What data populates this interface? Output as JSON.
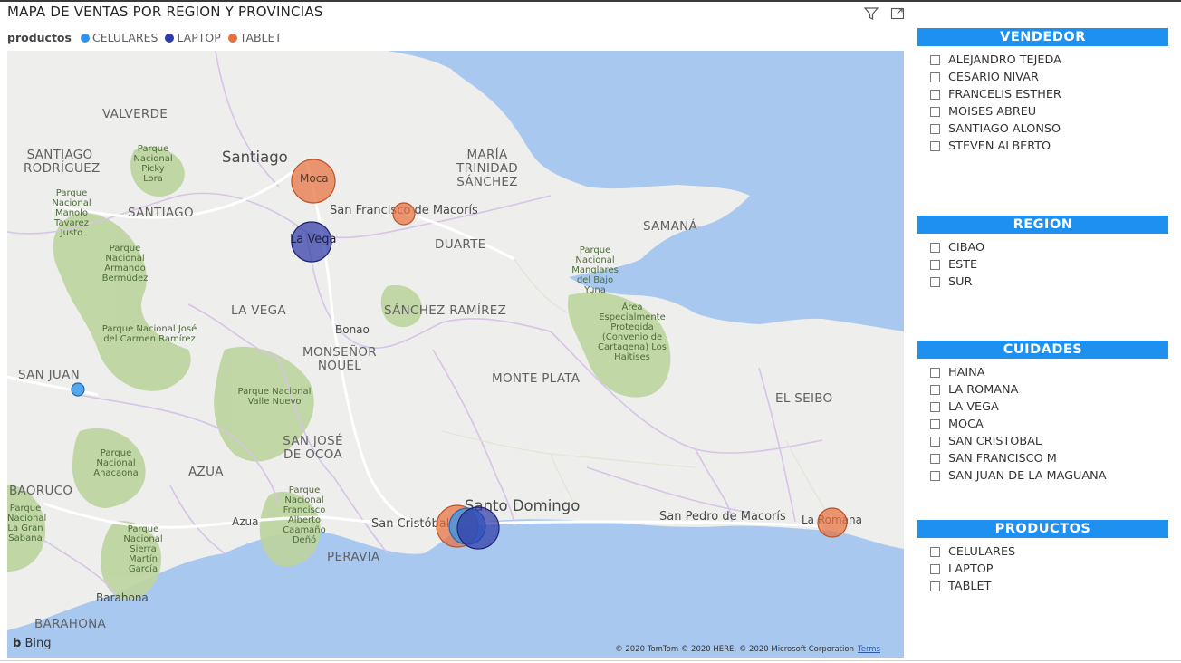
{
  "visual": {
    "title": "MAPA DE VENTAS POR REGION Y PROVINCIAS",
    "filter_icon": "filter-icon",
    "focus_icon": "focus-mode-icon"
  },
  "legend": {
    "title": "productos",
    "items": [
      {
        "label": "CELULARES",
        "color": "#2e93f0"
      },
      {
        "label": "LAPTOP",
        "color": "#2f3aa8"
      },
      {
        "label": "TABLET",
        "color": "#e8703f"
      }
    ]
  },
  "map": {
    "water_color": "#a8c8f0",
    "land_color": "#eeeeec",
    "park_color": "#bcd49e",
    "labels": {
      "valverde": "VALVERDE",
      "santiago_rodriguez": "SANTIAGO RODRÍGUEZ",
      "santiago_city": "Santiago",
      "santiago_prov": "SANTIAGO",
      "maria_trinidad": "MARÍA TRINIDAD SÁNCHEZ",
      "sf_macoris": "San Francisco de Macorís",
      "duarte": "DUARTE",
      "samana": "SAMANÁ",
      "la_vega_city": "La Vega",
      "la_vega_prov": "LA VEGA",
      "moca": "Moca",
      "sanchez_ramirez": "SÁNCHEZ RAMÍREZ",
      "bonao": "Bonao",
      "monsenor_nouel": "MONSEÑOR NOUEL",
      "monte_plata": "MONTE PLATA",
      "san_juan": "SAN JUAN",
      "el_seibo": "EL SEIBO",
      "san_jose_ocoa": "SAN JOSÉ DE OCOA",
      "azua_prov": "AZUA",
      "azua_city": "Azua",
      "baoruco": "BAORUCO",
      "santo_domingo": "Santo Domingo",
      "san_cristobal": "San Cristóbal",
      "peravia": "PERAVIA",
      "san_pedro": "San Pedro de Macorís",
      "la_romana": "La Romana",
      "barahona_city": "Barahona",
      "barahona_prov": "BARAHONA",
      "parque_picky": "Parque Nacional Picky Lora",
      "parque_manolo": "Parque Nacional Manolo Tavarez Justo",
      "parque_armando": "Parque Nacional Armando Bermúdez",
      "parque_jose": "Parque Nacional José del Carmen Ramírez",
      "parque_manglares": "Parque Nacional Manglares del Bajo Yuna",
      "area_protegida": "Área Especialmente Protegida (Convenio de Cartagena) Los Haitises",
      "parque_valle": "Parque Nacional Valle Nuevo",
      "parque_anacaona": "Parque Nacional Anacaona",
      "parque_francisco": "Parque Nacional Francisco Alberto Caamaño Deñó",
      "parque_sierra": "Parque Nacional Sierra Martín García",
      "parque_gran_sabana": "Parque Nacional La Gran Sabana"
    },
    "bing": "Bing",
    "copyright": "© 2020 TomTom © 2020 HERE, © 2020 Microsoft Corporation",
    "terms": "Terms"
  },
  "bubbles": [
    {
      "city": "Moca",
      "product": "TABLET"
    },
    {
      "city": "San Francisco de Macorís",
      "product": "TABLET"
    },
    {
      "city": "La Vega",
      "product": "LAPTOP"
    },
    {
      "city": "San Juan",
      "product": "CELULARES"
    },
    {
      "city": "San Cristóbal",
      "product": "TABLET / CELULARES"
    },
    {
      "city": "Santo Domingo",
      "product": "LAPTOP"
    },
    {
      "city": "La Romana",
      "product": "TABLET"
    }
  ],
  "slicers": [
    {
      "title": "VENDEDOR",
      "items": [
        "ALEJANDRO TEJEDA",
        "CESARIO NIVAR",
        "FRANCELIS ESTHER",
        "MOISES ABREU",
        "SANTIAGO ALONSO",
        "STEVEN ALBERTO"
      ]
    },
    {
      "title": "REGION",
      "items": [
        "CIBAO",
        "ESTE",
        "SUR"
      ]
    },
    {
      "title": "CUIDADES",
      "items": [
        "HAINA",
        "LA ROMANA",
        "LA VEGA",
        "MOCA",
        "SAN CRISTOBAL",
        "SAN FRANCISCO M",
        "SAN JUAN DE LA MAGUANA"
      ]
    },
    {
      "title": "PRODUCTOS",
      "items": [
        "CELULARES",
        "LAPTOP",
        "TABLET"
      ]
    }
  ]
}
